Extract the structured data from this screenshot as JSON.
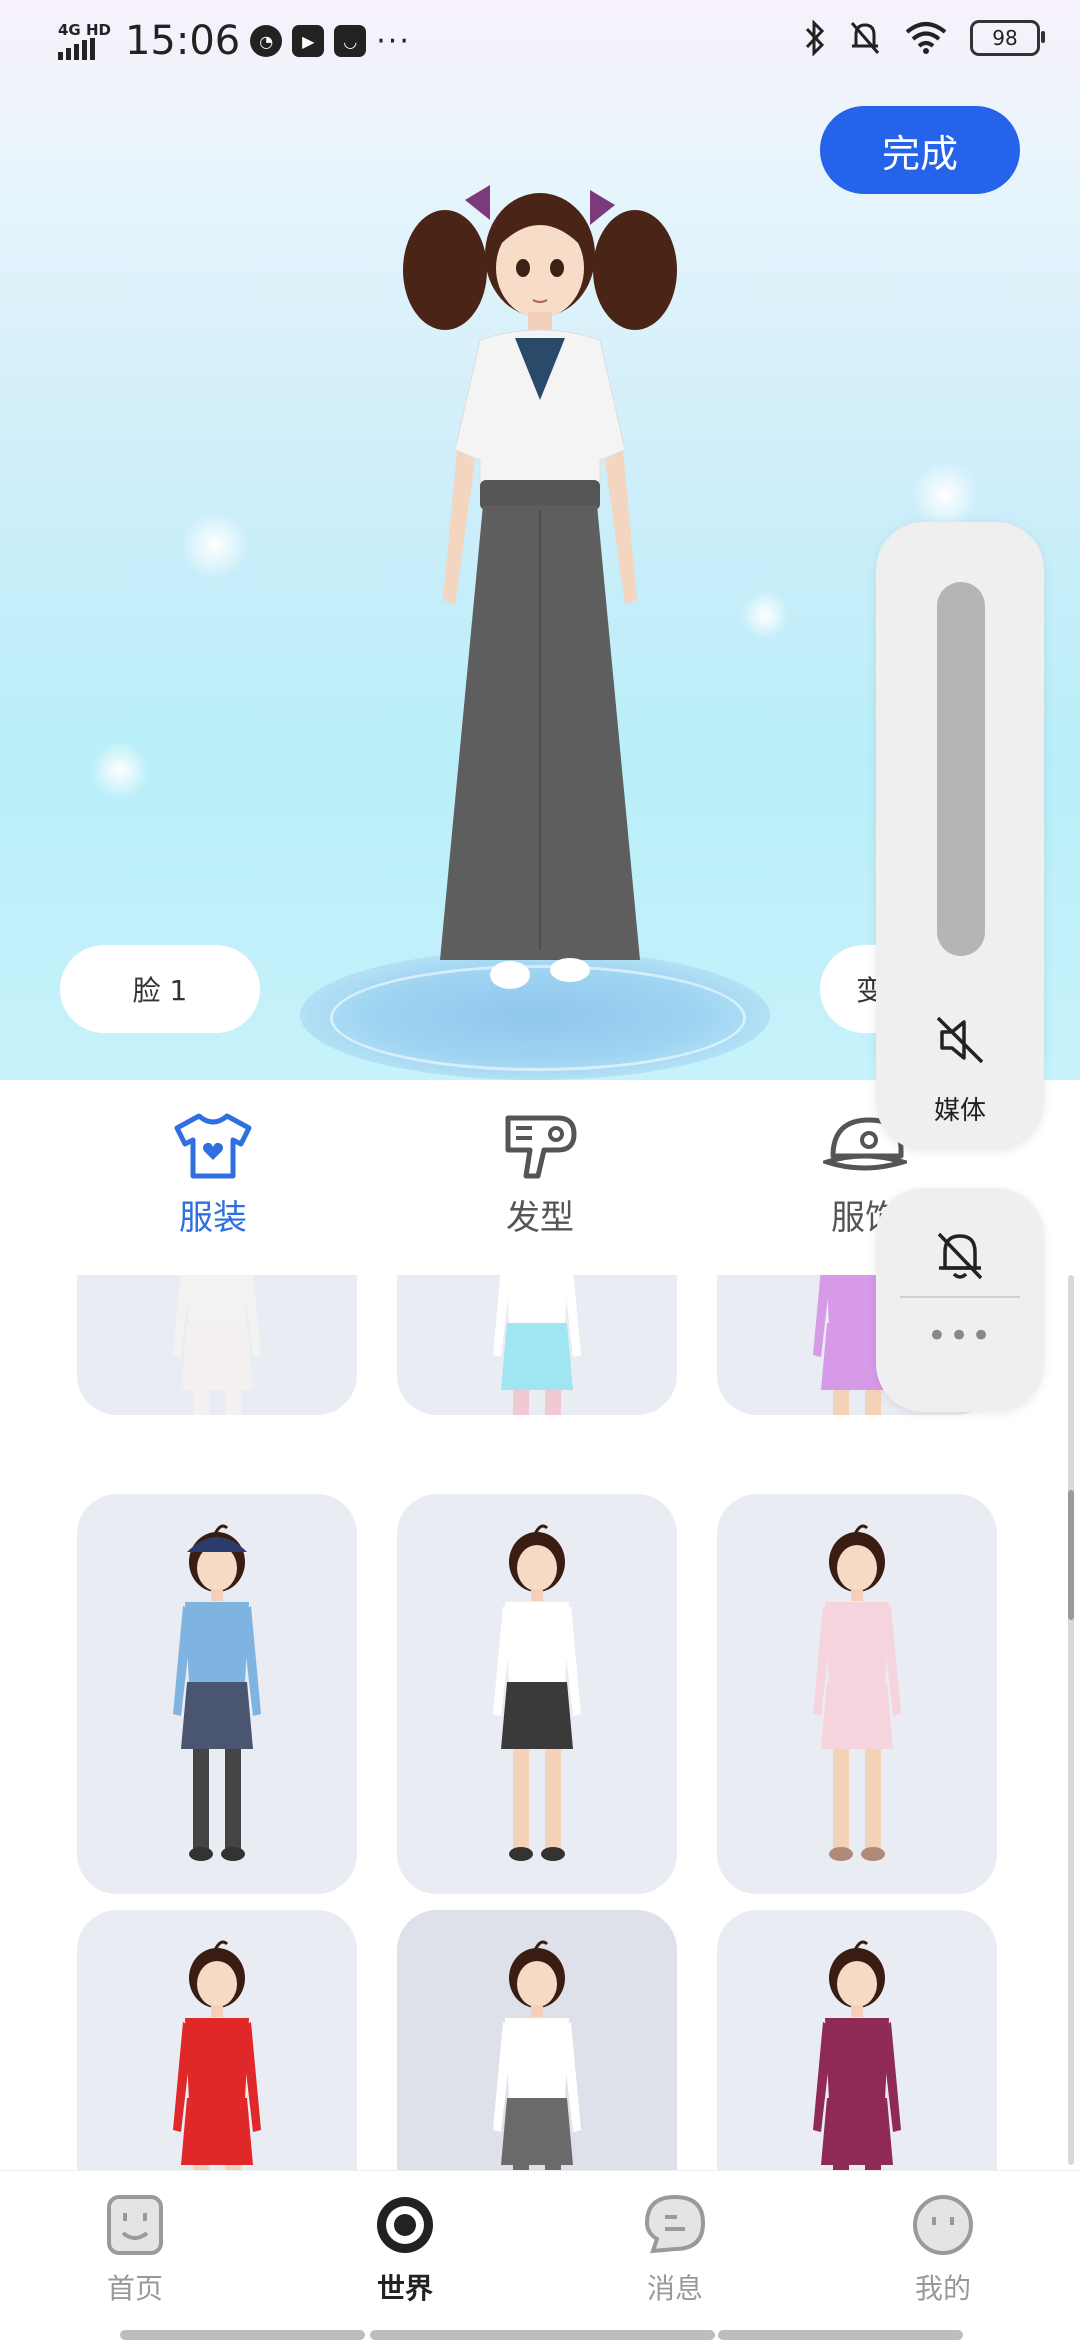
{
  "status_bar": {
    "network": "4G HD",
    "time": "15:06",
    "battery": "98"
  },
  "header": {
    "done_label": "完成"
  },
  "preview": {
    "face_label": "脸 1",
    "right_pill_label": "变"
  },
  "volume_overlay": {
    "media_label": "媒体",
    "more_label": "•••"
  },
  "categories": [
    {
      "label": "服装",
      "icon": "tshirt-heart-icon",
      "active": true
    },
    {
      "label": "发型",
      "icon": "hair-dryer-icon",
      "active": false
    },
    {
      "label": "服饰",
      "icon": "cap-icon",
      "active": false
    }
  ],
  "outfits": [
    {
      "name": "floral-kimono",
      "colors": {
        "top": "#f2f2f2",
        "bottom": "#f4f0f0",
        "legs": "#f4f0f0",
        "shoes": "#c0392b"
      }
    },
    {
      "name": "maid-dress",
      "colors": {
        "top": "#ffffff",
        "bottom": "#9fe6f2",
        "legs": "#f1c9d3",
        "shoes": "#333333"
      }
    },
    {
      "name": "pink-shorts",
      "colors": {
        "top": "#d79ae8",
        "bottom": "#d79ae8",
        "legs": "#f4d2b8",
        "shoes": "#c8a6e8"
      }
    },
    {
      "name": "police-uniform",
      "colors": {
        "top": "#7fb3e0",
        "bottom": "#4a5670",
        "legs": "#444444",
        "shoes": "#333333",
        "hat": "#2b3b6b"
      }
    },
    {
      "name": "white-shirt-skirt",
      "colors": {
        "top": "#ffffff",
        "bottom": "#3a3a3a",
        "legs": "#f4d2b8",
        "shoes": "#333333"
      }
    },
    {
      "name": "pink-dress",
      "colors": {
        "top": "#f6d4dd",
        "bottom": "#f6d4dd",
        "legs": "#f4d2b8",
        "shoes": "#b0897a"
      }
    },
    {
      "name": "red-ninja",
      "colors": {
        "top": "#e02828",
        "bottom": "#e02828",
        "legs": "#f4d2b8",
        "shoes": "#333333"
      }
    },
    {
      "name": "hakama",
      "colors": {
        "top": "#ffffff",
        "bottom": "#6a6a6a",
        "legs": "#6a6a6a",
        "shoes": "#ffffff"
      }
    },
    {
      "name": "maroon-jumpsuit",
      "colors": {
        "top": "#8e2a55",
        "bottom": "#8e2a55",
        "legs": "#8e2a55",
        "shoes": "#5a1a33"
      }
    }
  ],
  "nav": [
    {
      "label": "首页",
      "icon": "home-face-icon",
      "active": false
    },
    {
      "label": "世界",
      "icon": "world-target-icon",
      "active": true
    },
    {
      "label": "消息",
      "icon": "chat-bubble-icon",
      "active": false
    },
    {
      "label": "我的",
      "icon": "profile-face-icon",
      "active": false
    }
  ],
  "colors": {
    "accent": "#2563eb",
    "tab_active": "#2f6fe0",
    "card_bg": "#e9ecf3"
  }
}
